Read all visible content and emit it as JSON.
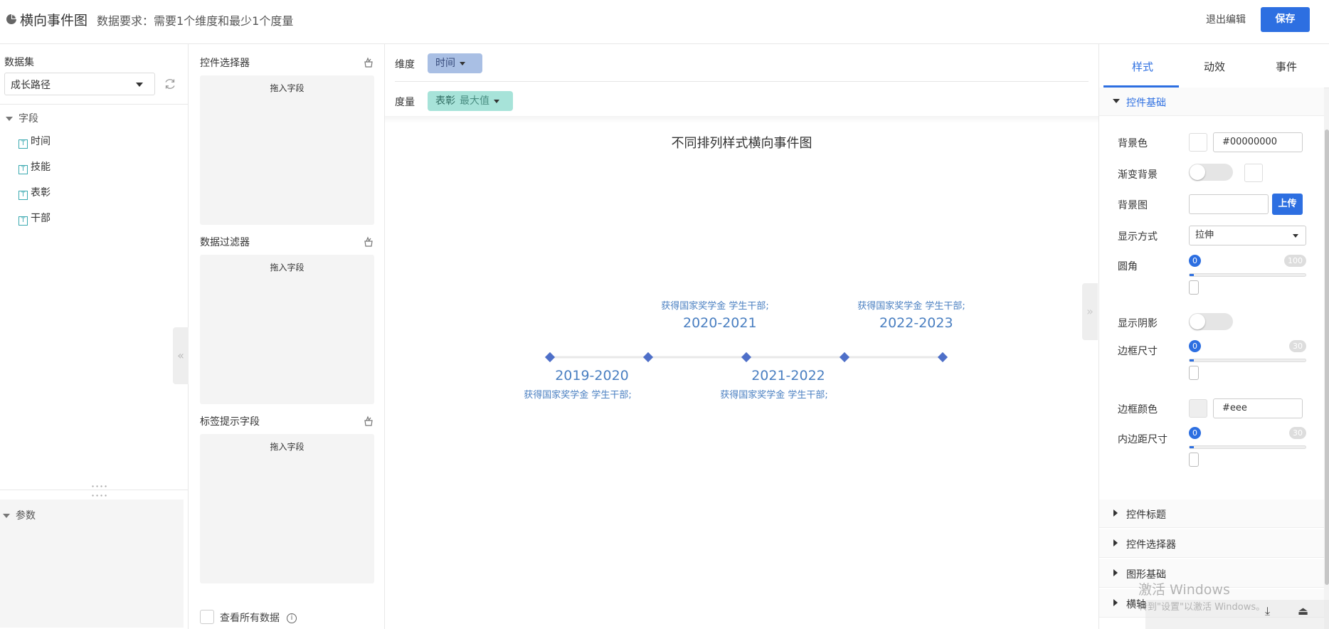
{
  "header": {
    "title": "横向事件图",
    "requirement": "数据要求：需要1个维度和最少1个度量",
    "exit_label": "退出编辑",
    "save_label": "保存"
  },
  "left_panel": {
    "dataset_label": "数据集",
    "dataset_value": "成长路径",
    "fields_header": "字段",
    "fields": [
      "时间",
      "技能",
      "表彰",
      "干部"
    ],
    "params_header": "参数"
  },
  "control_panel": {
    "sections": [
      {
        "title": "控件选择器",
        "placeholder": "拖入字段"
      },
      {
        "title": "数据过滤器",
        "placeholder": "拖入字段"
      },
      {
        "title": "标签提示字段",
        "placeholder": "拖入字段"
      }
    ],
    "view_all_label": "查看所有数据"
  },
  "shelves": {
    "dimension_label": "维度",
    "dimension_pill": "时间",
    "measure_label": "度量",
    "measure_pill": "表彰",
    "measure_agg": "最大值"
  },
  "chart_data": {
    "type": "timeline",
    "title": "不同排列样式横向事件图",
    "events": [
      {
        "time": "2019-2020",
        "text": "获得国家奖学金 学生干部;",
        "side": "below"
      },
      {
        "time": "2020-2021",
        "text": "获得国家奖学金 学生干部;",
        "side": "above"
      },
      {
        "time": "2021-2022",
        "text": "获得国家奖学金 学生干部;",
        "side": "below"
      },
      {
        "time": "2022-2023",
        "text": "获得国家奖学金 学生干部;",
        "side": "above"
      }
    ],
    "colors": {
      "marker": "#4e6fc8",
      "label": "#4a7fc1",
      "axis": "#e8e8e8"
    }
  },
  "right_panel": {
    "tabs": [
      "样式",
      "动效",
      "事件"
    ],
    "active_tab": "样式",
    "basic_section": "控件基础",
    "bg_color_label": "背景色",
    "bg_color_value": "#00000000",
    "gradient_label": "渐变背景",
    "bg_image_label": "背景图",
    "upload_label": "上传",
    "display_label": "显示方式",
    "display_value": "拉伸",
    "radius_label": "圆角",
    "radius_min": "0",
    "radius_max": "100",
    "radius_value": 0,
    "shadow_label": "显示阴影",
    "border_size_label": "边框尺寸",
    "border_min": "0",
    "border_max": "30",
    "border_color_label": "边框颜色",
    "border_color_value": "#eee",
    "padding_label": "内边距尺寸",
    "padding_min": "0",
    "padding_max": "30",
    "collapsed_sections": [
      "控件标题",
      "控件选择器",
      "图形基础",
      "横轴"
    ]
  },
  "system": {
    "watermark_line1": "激活 Windows",
    "watermark_line2": "转到\"设置\"以激活 Windows。"
  },
  "colors": {
    "accent": "#2d6fe1",
    "dimension_pill": "#a9bfe4",
    "measure_pill": "#a7e3d9"
  }
}
